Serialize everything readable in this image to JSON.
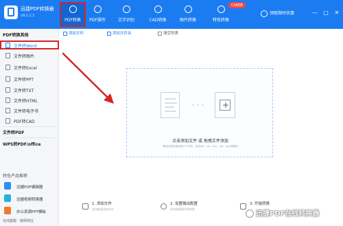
{
  "app": {
    "title": "迅捷PDF转换器",
    "version": "v9.1.2.1"
  },
  "nav": [
    {
      "label": "PDF转换",
      "icon": "pdf-convert-icon",
      "active": true
    },
    {
      "label": "PDF操作",
      "icon": "pdf-operate-icon",
      "active": false
    },
    {
      "label": "文字识别",
      "icon": "ocr-icon",
      "active": false
    },
    {
      "label": "CAD转换",
      "icon": "cad-icon",
      "active": false
    },
    {
      "label": "图片转换",
      "icon": "image-convert-icon",
      "active": false
    },
    {
      "label": "特色转换",
      "icon": "special-convert-icon",
      "active": false
    }
  ],
  "nav_badge": "CA转换",
  "vip_label": "领取限时优惠",
  "window_controls": [
    "—",
    "□",
    "✕"
  ],
  "sidebar": {
    "section1": "PDF转换其他",
    "items": [
      {
        "label": "文件转Word",
        "active": true
      },
      {
        "label": "文件转图片",
        "active": false
      },
      {
        "label": "文件转Excel",
        "active": false
      },
      {
        "label": "文件转PPT",
        "active": false
      },
      {
        "label": "文件转TXT",
        "active": false
      },
      {
        "label": "文件转HTML",
        "active": false
      },
      {
        "label": "文件转电子书",
        "active": false
      },
      {
        "label": "PDF转CAD",
        "active": false
      }
    ],
    "section2": "文件转PDF",
    "section3": "WPS转PDF/office",
    "section4": "特色产品推荐",
    "products": [
      {
        "label": "迅捷PDF编辑器",
        "color": "#2f8ff0"
      },
      {
        "label": "迅捷视频转换器",
        "color": "#27b2d8"
      },
      {
        "label": "办公资源PPT模板",
        "color": "#f07a2f"
      }
    ],
    "footer": "在线客服 · 官网地址"
  },
  "toolbar": {
    "add_file": "添加文件",
    "add_folder": "添加文件夹",
    "clear_list": "清空列表"
  },
  "dropzone": {
    "title": "点击添加文件 或 拖拽文件添加",
    "subtitle": "*最多支持批量添加50个文件，支持pdf、xls、xlsx、ppt、pptx等格式",
    "arrows": "› › ›"
  },
  "steps": [
    {
      "title": "1. 添加文件",
      "subtitle": "支持批量添加文件"
    },
    {
      "title": "2. 设置输出配置",
      "subtitle": "支持批量操作和转换"
    },
    {
      "title": "3. 开始转换",
      "subtitle": ""
    }
  ],
  "watermark": "迅捷PDF在线转换器",
  "colors": {
    "brand": "#1b7cf2",
    "highlight": "#d32424"
  }
}
